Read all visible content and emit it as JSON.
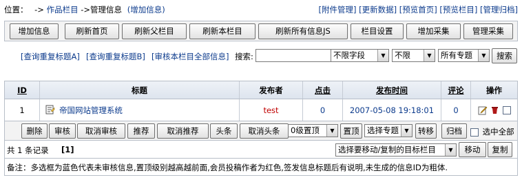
{
  "location": {
    "prefix": "位置：",
    "arrow1": "->",
    "crumb_column": "作品栏目",
    "arrow2": "->管理信息",
    "add_link": "(增加信息)"
  },
  "top_links": [
    "[附件管理]",
    "[更新数据]",
    "[预览首页]",
    "[预览栏目]",
    "[管理归档]"
  ],
  "toolbar": [
    "增加信息",
    "刷新首页",
    "刷新父栏目",
    "刷新本栏目",
    "刷新所有信息JS",
    "栏目设置",
    "增加采集",
    "管理采集"
  ],
  "search": {
    "link_a": "[查询重复标题A]",
    "link_b": "[查询重复标题B]",
    "link_audit": "[审核本栏目全部信息]",
    "label": "搜索:",
    "keyword": "",
    "field": "不限字段",
    "scope": "不限",
    "topic": "所有专题",
    "button": "搜索"
  },
  "table": {
    "headers": [
      "ID",
      "标题",
      "发布者",
      "点击",
      "发布时间",
      "评论",
      "操作"
    ],
    "rows": [
      {
        "id": "1",
        "title": "帝国网站管理系统",
        "author": "test",
        "clicks": "0",
        "time": "2007-05-08 19:18:01",
        "comments": "0"
      }
    ]
  },
  "actions": {
    "delete": "删除",
    "audit": "审核",
    "unaudit": "取消审核",
    "recommend": "推荐",
    "unrecommend": "取消推荐",
    "headline": "头条",
    "unheadline": "取消头条",
    "top_level": "0级置顶",
    "top_button": "置顶",
    "topic_select": "选择专题",
    "transfer": "转移",
    "archive": "归档",
    "select_all": "选中全部"
  },
  "pager": {
    "count_text": "共 1 条记录",
    "page": "[1]",
    "target_select": "选择要移动/复制的目标栏目",
    "move": "移动",
    "copy": "复制"
  },
  "note": "备注：多选框为蓝色代表未审核信息,置顶级别越高越前面,会员投稿作者为红色,签发信息标题后有说明,未生成的信息ID为粗体.",
  "colors": {
    "link": "#0b3a8c",
    "author_member": "#c00000",
    "title": "#0b3a8c",
    "header_bg": "#dde4ee",
    "border": "#b7bec8"
  }
}
